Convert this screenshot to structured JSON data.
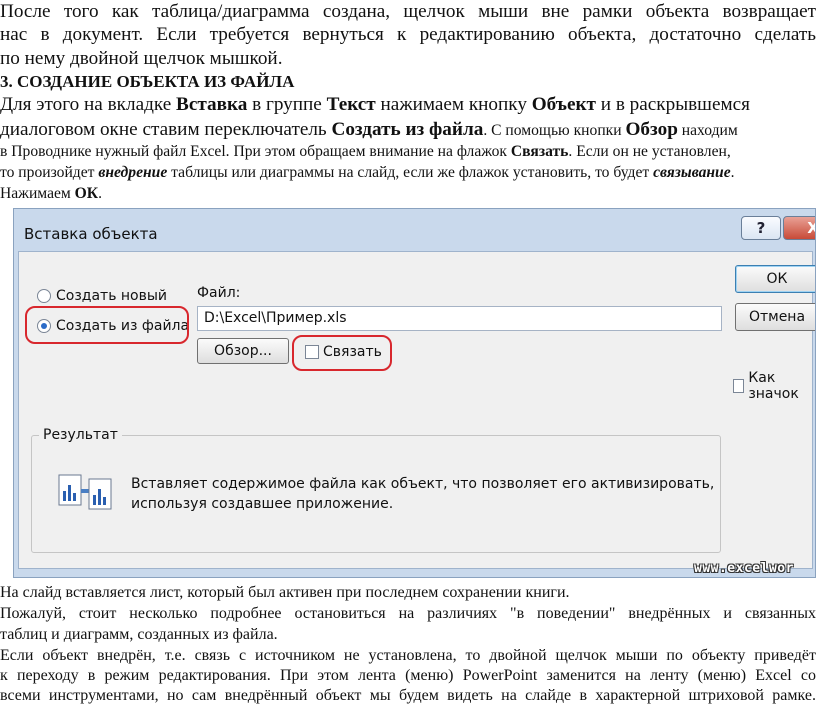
{
  "intro": {
    "line1": "После того как таблица/диаграмма создана, щелчок мыши вне рамки объекта возвращает",
    "line2": "нас в документ. Если требуется вернуться к редактированию объекта, достаточно сделать",
    "line3": "по нему двойной щелчок мышкой."
  },
  "section": {
    "heading": "3. СОЗДАНИЕ ОБЪЕКТА ИЗ ФАЙЛА",
    "l1": {
      "a": "Для этого на вкладке ",
      "b": "Вставка",
      "c": " в группе ",
      "d": "Текст",
      "e": " нажимаем кнопку ",
      "f": "Объект",
      "g": " и в раскрывшемся"
    },
    "l2": {
      "a": "диалоговом окне ставим переключатель ",
      "b": "Создать из файла",
      "c": ". С помощью кнопки ",
      "d": "Обзор",
      "e": " находим"
    },
    "l3": {
      "a": "в Проводнике нужный файл Excel. При этом обращаем внимание на флажок ",
      "b": "Связать",
      "c": ". Если он не установлен,"
    },
    "l4": {
      "a": "то произойдет ",
      "b": "внедрение",
      "c": " таблицы или диаграммы на слайд, если же флажок установить, то будет ",
      "d": "связывание",
      "e": "."
    },
    "l5": {
      "a": "Нажимаем ",
      "b": "ОК",
      "c": "."
    }
  },
  "dialog": {
    "title": "Вставка объекта",
    "help_label": "?",
    "close_label": "X",
    "radio_new": "Создать новый",
    "radio_from_file": "Создать из файла",
    "file_label": "Файл:",
    "file_path": "D:\\Excel\\Пример.xls",
    "browse_label": "Обзор...",
    "link_label": "Связать",
    "ok_label": "ОК",
    "cancel_label": "Отмена",
    "icon_label": "Как значок",
    "result_title": "Результат",
    "result_line1": "Вставляет содержимое файла как объект, что позволяет его активизировать,",
    "result_line2": "используя создавшее приложение.",
    "watermark": "www.excelwor",
    "highlight_color": "#d8272d"
  },
  "outro": {
    "line1": "На слайд вставляется лист, который был активен при последнем сохранении книги.",
    "line2": "Пожалуй, стоит несколько подробнее остановиться на различиях \"в поведении\" внедрённых и связанных",
    "line3": "таблиц и диаграмм, созданных из файла.",
    "line4": "Если объект внедрён, т.е. связь с источником не установлена, то двойной щелчок мыши по объекту приведёт",
    "line5": "к переходу в режим редактирования. При этом лента (меню) PowerPoint заменится на ленту (меню) Excel со",
    "line6": "всеми инструментами, но сам внедрённый объект мы будем видеть на слайде в характерной штриховой рамке."
  }
}
